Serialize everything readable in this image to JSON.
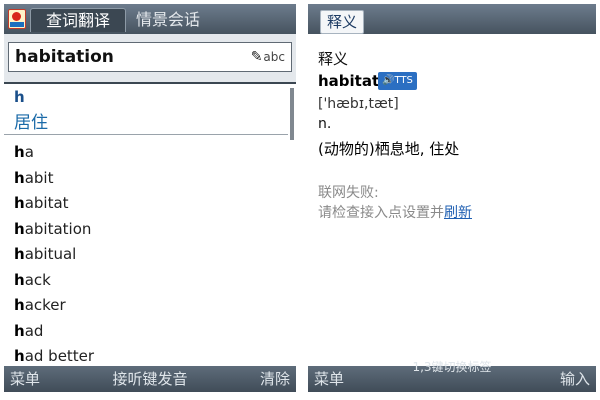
{
  "left": {
    "tabs": {
      "active": "查词翻译",
      "inactive": "情景会话"
    },
    "search": {
      "value": "habitation",
      "input_mode": "abc"
    },
    "match": {
      "key": "h",
      "meaning": "居住"
    },
    "list": [
      {
        "prefix": "h",
        "rest": "a"
      },
      {
        "prefix": "h",
        "rest": "abit"
      },
      {
        "prefix": "h",
        "rest": "abitat"
      },
      {
        "prefix": "h",
        "rest": "abitation"
      },
      {
        "prefix": "h",
        "rest": "abitual"
      },
      {
        "prefix": "h",
        "rest": "ack"
      },
      {
        "prefix": "h",
        "rest": "acker"
      },
      {
        "prefix": "h",
        "rest": "ad"
      },
      {
        "prefix": "h",
        "rest": "ad better"
      }
    ],
    "bottom": {
      "left": "菜单",
      "center": "接听键发音",
      "right": "清除"
    }
  },
  "right": {
    "section_tab": "释义",
    "heading": "释义",
    "headword": "habitat",
    "tts": "TTS",
    "phonetic": "['hæbɪ,tæt]",
    "pos": "n.",
    "definition": "(动物的)栖息地, 住处",
    "error_title": "联网失败:",
    "error_msg": "请检查接入点设置并",
    "refresh": "刷新",
    "bottom": {
      "left": "菜单",
      "hint": "1,3键切换标签",
      "right": "输入"
    }
  },
  "colors": {
    "bar": "#46535f",
    "accent": "#1a6aa8",
    "tts": "#2b6fc2"
  },
  "icons": {
    "app": "dictionary-app-icon",
    "speaker": "speaker-icon",
    "pen": "handwriting-pen-icon"
  }
}
